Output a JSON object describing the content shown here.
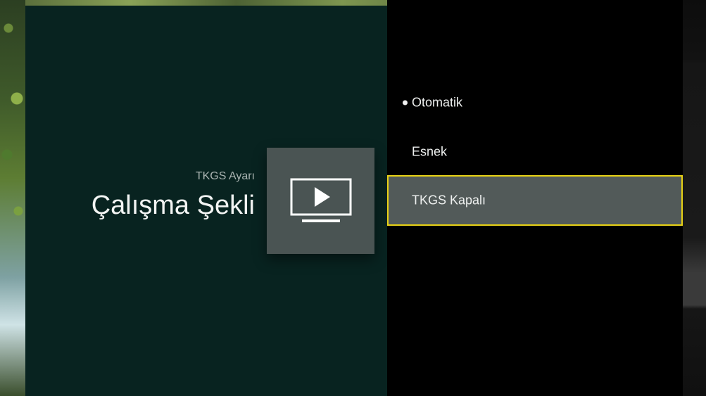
{
  "header": {
    "subtitle": "TKGS Ayarı",
    "title": "Çalışma Şekli"
  },
  "icon": {
    "name": "tv-play-icon"
  },
  "options": [
    {
      "label": "Otomatik",
      "selected": true,
      "focused": false
    },
    {
      "label": "Esnek",
      "selected": false,
      "focused": false
    },
    {
      "label": "TKGS Kapalı",
      "selected": false,
      "focused": true
    }
  ],
  "colors": {
    "panel_bg": "#082320",
    "focus_border": "#e8d215",
    "focus_bg": "#525a59",
    "icon_tile": "#4a5453"
  }
}
